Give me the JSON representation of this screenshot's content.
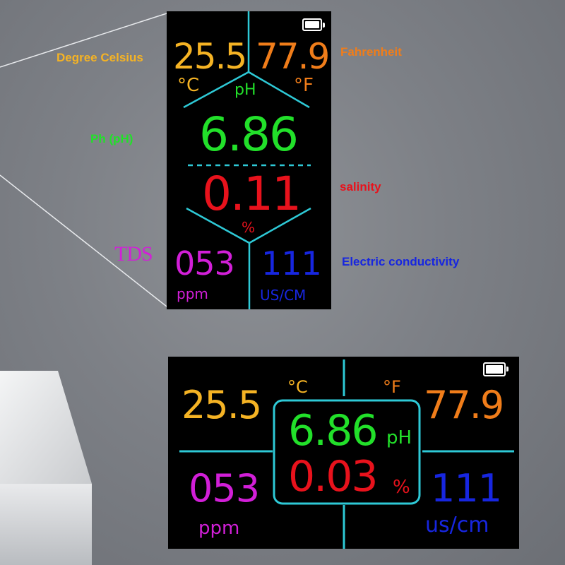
{
  "colors": {
    "celsius": "#f5b324",
    "fahrenheit": "#f07d1a",
    "ph": "#22e02a",
    "salinity": "#e8121c",
    "tds": "#d21fd8",
    "conductivity": "#1726e0",
    "divider": "#2ec9d6",
    "screen_bg": "#000000"
  },
  "callouts": {
    "celsius": "Degree Celsius",
    "fahrenheit": "Fahrenheit",
    "ph": "Ph (pH)",
    "salinity": "salinity",
    "tds": "TDS",
    "conductivity": "Electric conductivity"
  },
  "display_portrait": {
    "battery_icon": "battery-full-icon",
    "celsius_value": "25.5",
    "celsius_unit": "°C",
    "fahrenheit_value": "77.9",
    "fahrenheit_unit": "°F",
    "ph_label": "pH",
    "ph_value": "6.86",
    "salinity_value": "0.11",
    "salinity_unit": "%",
    "tds_value": "053",
    "tds_unit": "ppm",
    "conductivity_value": "111",
    "conductivity_unit": "US/CM"
  },
  "display_landscape": {
    "battery_icon": "battery-full-icon",
    "celsius_value": "25.5",
    "celsius_unit": "°C",
    "fahrenheit_value": "77.9",
    "fahrenheit_unit": "°F",
    "ph_value": "6.86",
    "ph_label": "pH",
    "salinity_value": "0.03",
    "salinity_unit": "%",
    "tds_value": "053",
    "tds_unit": "ppm",
    "conductivity_value": "111",
    "conductivity_unit": "us/cm"
  }
}
